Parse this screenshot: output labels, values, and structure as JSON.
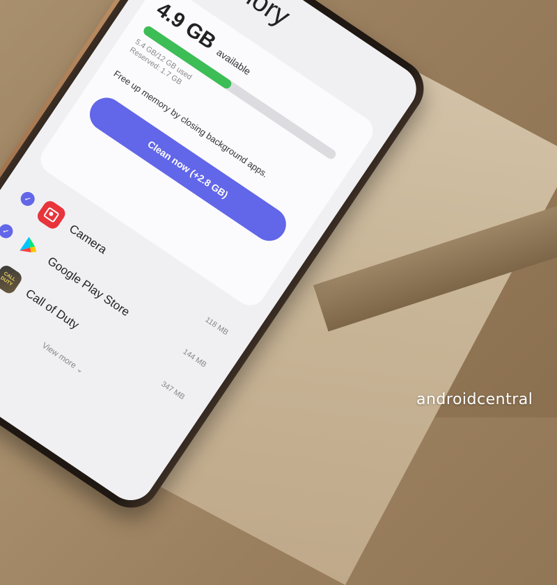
{
  "screen": {
    "title": "Memory",
    "available_value": "4.9 GB",
    "available_label": "available",
    "used_text": "5.4 GB/12 GB used",
    "reserved_text": "Reserved: 1.7 GB",
    "usage_fraction": 0.45,
    "hint": "Free up memory by closing background apps.",
    "clean_button": "Clean now (+2.8 GB)",
    "apps": [
      {
        "name": "Camera",
        "size": "118 MB",
        "icon": "camera-icon",
        "checked": true
      },
      {
        "name": "Google Play Store",
        "size": "144 MB",
        "icon": "play-store-icon",
        "checked": true
      },
      {
        "name": "Call of Duty",
        "size": "347 MB",
        "icon": "call-of-duty-icon",
        "checked": true
      }
    ],
    "view_more": "View more"
  },
  "colors": {
    "accent": "#6266e8",
    "usage_bar": "#3dbd56",
    "camera_icon": "#e8343b"
  },
  "watermark": "androidcentral"
}
